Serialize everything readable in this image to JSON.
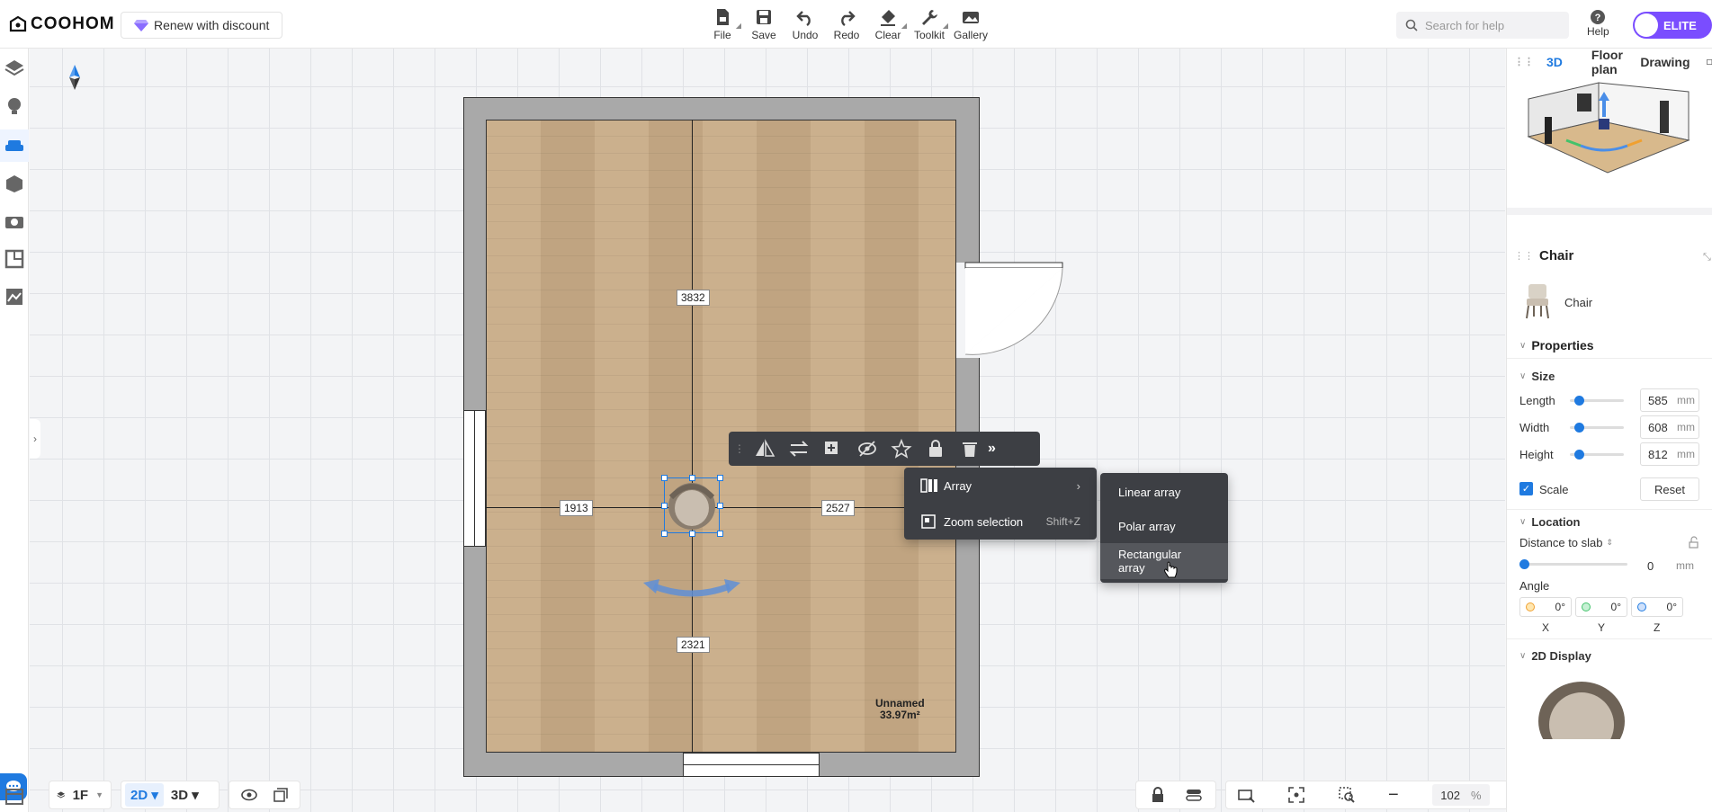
{
  "app": {
    "logo_text": "COOHOM",
    "renew_label": "Renew with discount"
  },
  "toolbar": {
    "items": [
      {
        "label": "File",
        "icon": "file-icon"
      },
      {
        "label": "Save",
        "icon": "save-icon"
      },
      {
        "label": "Undo",
        "icon": "undo-icon"
      },
      {
        "label": "Redo",
        "icon": "redo-icon"
      },
      {
        "label": "Clear",
        "icon": "eraser-icon"
      },
      {
        "label": "Toolkit",
        "icon": "wrench-icon"
      },
      {
        "label": "Gallery",
        "icon": "gallery-icon"
      }
    ]
  },
  "search": {
    "placeholder": "Search for help"
  },
  "help": {
    "label": "Help"
  },
  "elite": {
    "label": "ELITE"
  },
  "view_tabs": {
    "tab_3d": "3D",
    "floor_plan": "Floor plan",
    "drawing": "Drawing"
  },
  "plan": {
    "dim_vertical_top": "3832",
    "dim_vertical_bottom": "2321",
    "dim_left": "1913",
    "dim_right": "2527",
    "room_name": "Unnamed",
    "room_area": "33.97m²"
  },
  "context_menu": {
    "array_label": "Array",
    "zoom_selection_label": "Zoom selection",
    "zoom_shortcut": "Shift+Z",
    "submenu": [
      "Linear array",
      "Polar array",
      "Rectangular array"
    ]
  },
  "properties": {
    "object_name": "Chair",
    "object_item_label": "Chair",
    "section_properties": "Properties",
    "section_size": "Size",
    "length_label": "Length",
    "length_value": "585",
    "width_label": "Width",
    "width_value": "608",
    "height_label": "Height",
    "height_value": "812",
    "unit": "mm",
    "scale_label": "Scale",
    "reset_label": "Reset",
    "section_location": "Location",
    "distance_label": "Distance to slab",
    "distance_value": "0",
    "angle_label": "Angle",
    "angle_x": "0°",
    "angle_y": "0°",
    "angle_z": "0°",
    "axis_x": "X",
    "axis_y": "Y",
    "axis_z": "Z",
    "section_2d": "2D Display"
  },
  "bottom": {
    "floor": "1F",
    "mode_2d": "2D",
    "mode_3d": "3D",
    "zoom": "102",
    "zoom_unit": "%"
  },
  "colors": {
    "accent": "#1f7ae0",
    "elite": "#7a4dff",
    "menu_bg": "#3d3f44",
    "wall": "#a9a9a9",
    "floor": "#c8ab86"
  }
}
